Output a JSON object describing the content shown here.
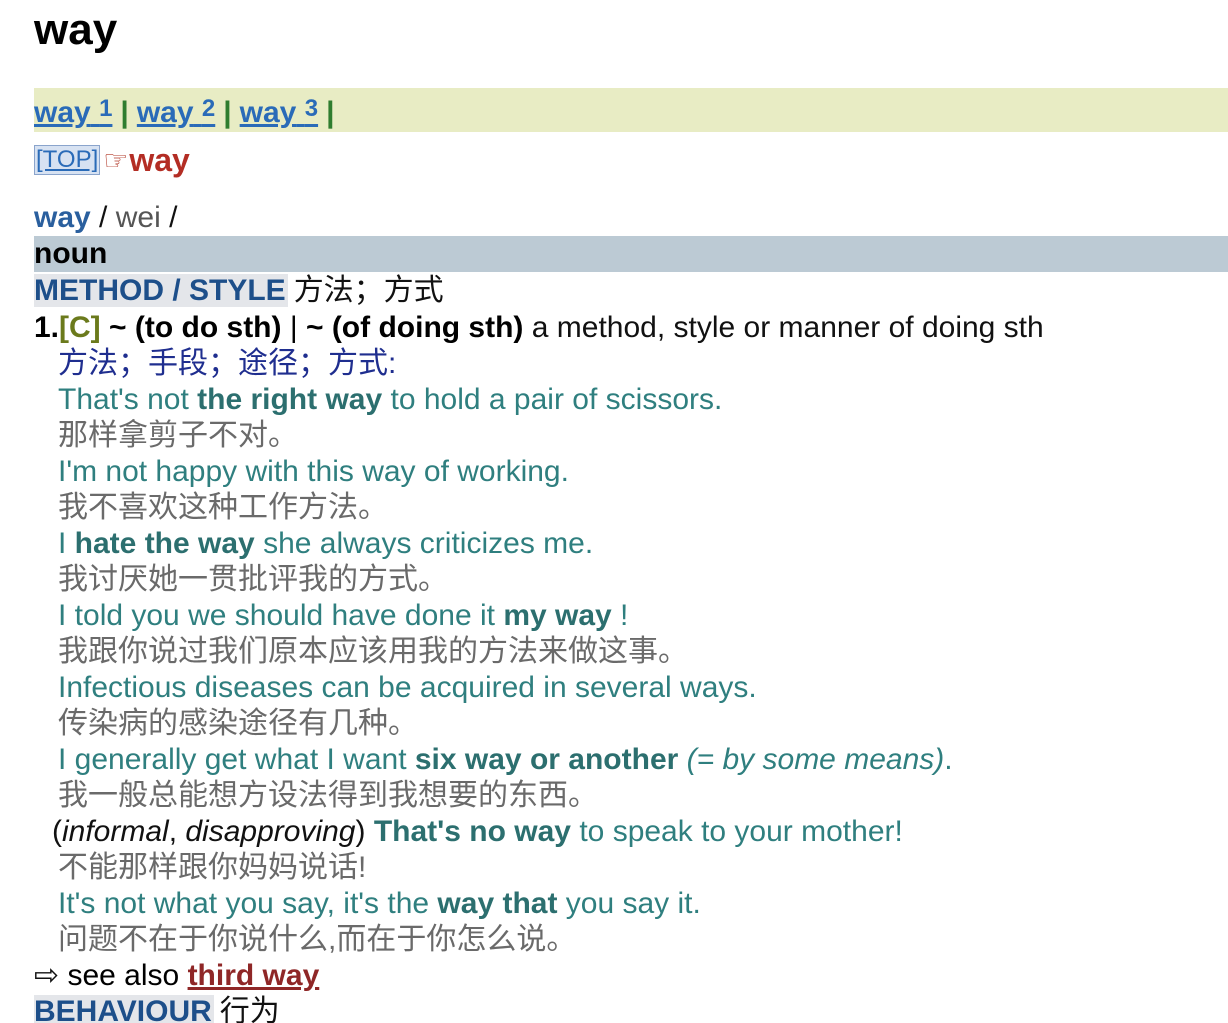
{
  "title": "way",
  "homographs": [
    {
      "label": "way",
      "num": "1"
    },
    {
      "label": "way",
      "num": "2"
    },
    {
      "label": "way",
      "num": "3"
    }
  ],
  "homograph_sep": "|",
  "top": {
    "link": "[TOP]",
    "icon": "pointing-hand-icon",
    "word": "way"
  },
  "pron": {
    "word": "way",
    "slash1": " / ",
    "ipa": "wei",
    "slash2": " /"
  },
  "pos": "noun",
  "sense1_header": {
    "label": "METHOD / STYLE",
    "cn": "方法；方式"
  },
  "definition": {
    "num": "1.",
    "gram": "[C]",
    "pattern": " ~ (to do sth) ",
    "sep": "|",
    "pattern2": " ~ (of doing sth)",
    "text": " a method, style or manner of doing sth"
  },
  "cn_def": "方法；手段；途径；方式:",
  "examples": {
    "e1": {
      "pre": "That's not ",
      "bold": "the right way",
      "post": " to hold a pair of scissors.",
      "cn": "那样拿剪子不对。"
    },
    "e2": {
      "text": "I'm not happy with this way of working.",
      "cn": "我不喜欢这种工作方法。"
    },
    "e3": {
      "pre": "I ",
      "bold": "hate the way",
      "post": " she always criticizes me.",
      "cn": "我讨厌她一贯批评我的方式。"
    },
    "e4": {
      "pre": "I told you we should have done it ",
      "bold": "my way",
      "post": " !",
      "cn": "我跟你说过我们原本应该用我的方法来做这事。"
    },
    "e5": {
      "text": "Infectious diseases can be acquired in several ways.",
      "cn": "传染病的感染途径有几种。"
    },
    "e6": {
      "pre": "I generally get what I want ",
      "bold": "six way or another",
      "gloss": " (= by some means)",
      "post": ".",
      "cn": "我一般总能想方设法得到我想要的东西。"
    },
    "e7": {
      "open": "(",
      "reg1": "informal",
      "comma": ", ",
      "reg2": "disapproving",
      "close": ") ",
      "bold": "That's no way",
      "post": " to speak to your mother!",
      "cn": "不能那样跟你妈妈说话!"
    },
    "e8": {
      "pre": "It's not what you say, it's the ",
      "bold": "way that",
      "post": " you say it.",
      "cn": "问题不在于你说什么,而在于你怎么说。"
    }
  },
  "see_also": {
    "icon": "right-arrow-icon",
    "text": " see also ",
    "link": "third way"
  },
  "sense2_header": {
    "label": "BEHAVIOUR",
    "cn": "行为"
  }
}
